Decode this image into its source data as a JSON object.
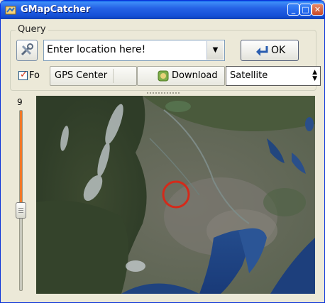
{
  "window": {
    "title": "GMapCatcher"
  },
  "query": {
    "group_label": "Query",
    "location_value": "Enter location here!",
    "ok_label": "OK"
  },
  "options": {
    "checkbox_label": "Fo",
    "checkbox_checked": true,
    "gps_mode": "GPS Center",
    "download_label": "Download",
    "map_type": "Satellite"
  },
  "zoom": {
    "level": "9"
  },
  "colors": {
    "title_bar": "#2663E6",
    "slider_fill": "#F07828",
    "center_marker": "#D42A1A"
  }
}
